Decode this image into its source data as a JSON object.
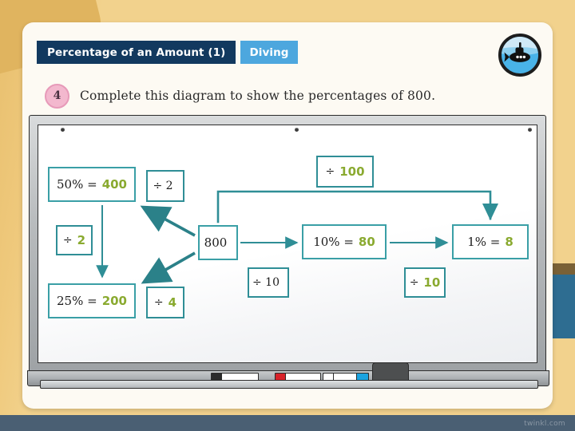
{
  "header": {
    "title_tab": "Percentage of an Amount (1)",
    "category_tab": "Diving",
    "logo_icon": "submarine-icon"
  },
  "question": {
    "number": "4",
    "text": "Complete this diagram to show the percentages of 800."
  },
  "whiteboard": {
    "tray_items": [
      "black-marker",
      "red-marker",
      "blue-marker",
      "eraser"
    ]
  },
  "colors": {
    "title_tab_bg": "#12395f",
    "category_tab_bg": "#4da7de",
    "node_border": "#3a9fa6",
    "connector": "#2f8e96",
    "answer_text": "#8aaa30",
    "wall": "#f2d28d",
    "backdrop": "#4a5f73",
    "question_badge": "#f3b8ce"
  },
  "diagram": {
    "type": "flow-diagram",
    "start_value": "800",
    "nodes": [
      {
        "id": "n-50",
        "label": "50% =",
        "answer": "400",
        "filled": true
      },
      {
        "id": "n-div2a",
        "label": "÷ 2",
        "answer": "",
        "filled": false
      },
      {
        "id": "n-div2b",
        "label": "÷",
        "answer": "2",
        "filled": true
      },
      {
        "id": "n-25",
        "label": "25% =",
        "answer": "200",
        "filled": true
      },
      {
        "id": "n-div4",
        "label": "÷",
        "answer": "4",
        "filled": true
      },
      {
        "id": "n-800",
        "label": "800",
        "answer": "",
        "filled": false
      },
      {
        "id": "n-div10a",
        "label": "÷ 10",
        "answer": "",
        "filled": false
      },
      {
        "id": "n-10pc",
        "label": "10% =",
        "answer": "80",
        "filled": true
      },
      {
        "id": "n-div10b",
        "label": "÷",
        "answer": "10",
        "filled": true
      },
      {
        "id": "n-1pc",
        "label": "1% =",
        "answer": "8",
        "filled": true
      },
      {
        "id": "n-div100",
        "label": "÷",
        "answer": "100",
        "filled": true
      }
    ],
    "edges": [
      {
        "from": "800",
        "to": "50% = 400",
        "operation": "÷ 2",
        "style": "diagonal-arrow"
      },
      {
        "from": "800",
        "to": "25% = 200",
        "operation": "÷ 4",
        "style": "diagonal-arrow"
      },
      {
        "from": "50% = 400",
        "to": "25% = 200",
        "operation": "÷ 2",
        "style": "vertical-arrow"
      },
      {
        "from": "800",
        "to": "10% = 80",
        "operation": "÷ 10",
        "style": "horizontal-arrow"
      },
      {
        "from": "10% = 80",
        "to": "1% = 8",
        "operation": "÷ 10",
        "style": "horizontal-arrow"
      },
      {
        "from": "800",
        "to": "1% = 8",
        "operation": "÷ 100",
        "style": "bracket-arrow"
      }
    ]
  },
  "footer": {
    "watermark": "twinkl.com"
  }
}
